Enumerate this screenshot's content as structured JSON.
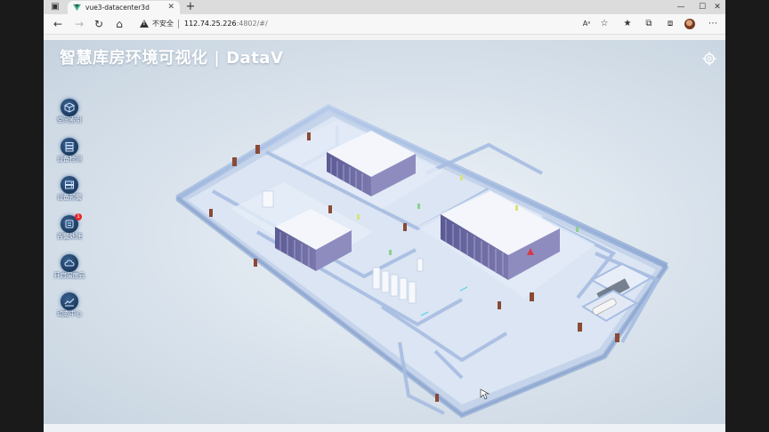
{
  "browser": {
    "tab_title": "vue3-datacenter3d",
    "security_label": "不安全",
    "url_host": "112.74.25.226",
    "url_path": ":4802/#/"
  },
  "app": {
    "title": "智慧库房环境可视化 | DataV",
    "menu": [
      {
        "label": "空间索引",
        "icon": "cube-icon"
      },
      {
        "label": "设备检测",
        "icon": "server-icon"
      },
      {
        "label": "设备预警",
        "icon": "alert-server-icon"
      },
      {
        "label": "告警处理",
        "icon": "alarm-icon",
        "badge": "1"
      },
      {
        "label": "开启温度云",
        "icon": "cloud-icon"
      },
      {
        "label": "动态中心",
        "icon": "chart-icon"
      }
    ]
  },
  "colors": {
    "accent": "#2a4a78",
    "badge": "#e8262a",
    "wall": "#9fb7dc",
    "floor": "#d8e3f1"
  }
}
